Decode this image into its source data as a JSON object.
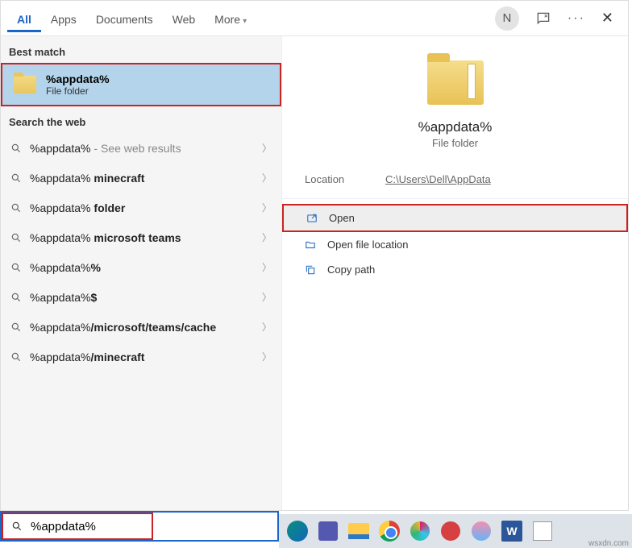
{
  "tabs": {
    "all": "All",
    "apps": "Apps",
    "documents": "Documents",
    "web": "Web",
    "more": "More"
  },
  "header": {
    "avatar_initial": "N"
  },
  "left": {
    "best_match_label": "Best match",
    "best_match": {
      "title": "%appdata%",
      "subtitle": "File folder"
    },
    "search_web_label": "Search the web",
    "web_results": [
      {
        "query": "%appdata%",
        "bold": "",
        "hint": " - See web results"
      },
      {
        "query": "%appdata%",
        "bold": " minecraft",
        "hint": ""
      },
      {
        "query": "%appdata%",
        "bold": " folder",
        "hint": ""
      },
      {
        "query": "%appdata%",
        "bold": " microsoft teams",
        "hint": ""
      },
      {
        "query": "%appdata%",
        "bold": "%",
        "hint": ""
      },
      {
        "query": "%appdata%",
        "bold": "$",
        "hint": ""
      },
      {
        "query": "%appdata%",
        "bold": "/microsoft/teams/cache",
        "hint": ""
      },
      {
        "query": "%appdata%",
        "bold": "/minecraft",
        "hint": ""
      }
    ]
  },
  "preview": {
    "title": "%appdata%",
    "subtitle": "File folder",
    "location_label": "Location",
    "location_value": "C:\\Users\\Dell\\AppData",
    "actions": {
      "open": "Open",
      "open_loc": "Open file location",
      "copy": "Copy path"
    }
  },
  "search": {
    "value": "%appdata%"
  },
  "taskbar": {
    "word_label": "W"
  },
  "watermark": "wsxdn.com"
}
